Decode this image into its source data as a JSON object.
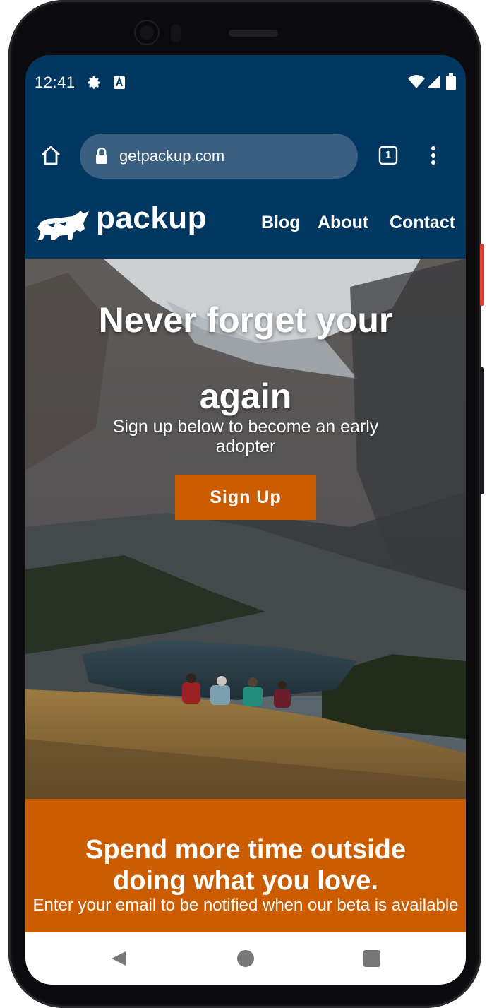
{
  "status_bar": {
    "time": "12:41",
    "icons": [
      "gear-icon",
      "a-badge-icon",
      "wifi-icon",
      "signal-icon",
      "battery-icon"
    ]
  },
  "browser": {
    "url": "getpackup.com",
    "tab_count": "1",
    "icons": [
      "home-icon",
      "lock-icon",
      "tab-switcher-icon",
      "more-vert-icon"
    ]
  },
  "site": {
    "brand": "packup",
    "nav": [
      {
        "label": "Blog"
      },
      {
        "label": "About"
      },
      {
        "label": "Contact"
      }
    ]
  },
  "hero": {
    "title_line1": "Never forget your",
    "title_line2": "again",
    "subtitle": "Sign up below to become an early adopter",
    "cta_label": "Sign Up"
  },
  "promo": {
    "title": "Spend more time outside doing what you love.",
    "subtitle": "Enter your email to be notified when our beta is available"
  },
  "colors": {
    "nav_bg": "#003760",
    "accent": "#cb5c00",
    "url_box": "#3a5f80"
  },
  "android_nav": {
    "icons": [
      "back-icon",
      "home-circle-icon",
      "recents-icon"
    ]
  }
}
